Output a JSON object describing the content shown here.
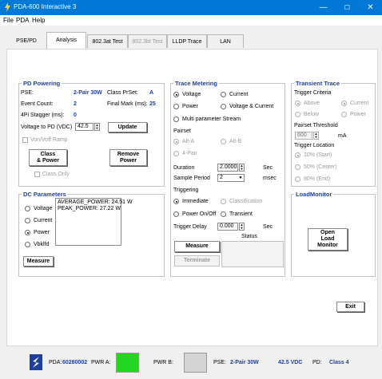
{
  "window": {
    "title": "PDA-600 Interactive 3",
    "min": "—",
    "max": "☐",
    "close": "✕"
  },
  "menu": [
    "File",
    "PDA",
    "Help"
  ],
  "tabs": [
    {
      "label": "PSE/PD"
    },
    {
      "label": "Analysis"
    },
    {
      "label": "802.3at Test"
    },
    {
      "label": "802.3bt Test"
    },
    {
      "label": "LLDP Trace"
    },
    {
      "label": "LAN"
    }
  ],
  "pd_powering": {
    "title": "PD Powering",
    "pse_label": "PSE:",
    "pse_value": "2-Pair 30W",
    "class_prset_label": "Class PrSet:",
    "class_prset_value": "A",
    "event_count_label": "Event Count:",
    "event_count_value": "2",
    "final_mark_label": "Final Mark (ms):",
    "final_mark_value": "25",
    "stagger_label": "4Pi Stagger (ms):",
    "stagger_value": "0",
    "voltage_label": "Voltage to PD (VDC)",
    "voltage_value": "42.5",
    "update_button": "Update",
    "von_voff": "Von/Voff Ramp",
    "class_power_button": "Class\n& Power",
    "remove_power_button": "Remove\nPower",
    "class_only": "Class Only"
  },
  "dc_parameters": {
    "title": "DC Parameters",
    "options": [
      "Voltage",
      "Current",
      "Power",
      "Vbklfd"
    ],
    "selected": "Power",
    "readout": "AVERAGE_POWER: 24.51 W\nPEAK_POWER: 27.22 W",
    "measure_button": "Measure"
  },
  "trace_metering": {
    "title": "Trace Metering",
    "modes": [
      "Voltage",
      "Current",
      "Power",
      "Voltage & Current",
      "Multi parameter Stream"
    ],
    "selected_mode": "Voltage",
    "pairset_label": "Pairset",
    "pairsets": [
      "Alt-A",
      "Alt-B",
      "4-Pair"
    ],
    "duration_label": "Duration",
    "duration_value": "2.0000",
    "duration_unit": "Sec",
    "sample_period_label": "Sample Period",
    "sample_period_value": "2",
    "sample_period_unit": "msec",
    "triggering_label": "Triggering",
    "triggers": [
      "Immediate",
      "Classification",
      "Power On/Off",
      "Transient"
    ],
    "selected_trigger": "Immediate",
    "trigger_delay_label": "Trigger Delay",
    "trigger_delay_value": "0.000",
    "trigger_delay_unit": "Sec",
    "status_label": "Status",
    "measure_button": "Measure",
    "terminate_button": "Terminate"
  },
  "transient_trace": {
    "title": "Transient Trace",
    "criteria_label": "Trigger Criteria",
    "criteria": [
      "Above",
      "Current",
      "Below",
      "Power"
    ],
    "threshold_label": "Pairset Threshold",
    "threshold_value": "600",
    "threshold_unit": "mA",
    "location_label": "Trigger Location",
    "locations": [
      "10% (Start)",
      "50% (Center)",
      "90% (End)"
    ]
  },
  "load_monitor": {
    "title": "LoadMonitor",
    "open_button": "Open\nLoad\nMonitor"
  },
  "exit_button": "Exit",
  "status_bar": {
    "pda_label": "PDA:",
    "pda_value": "60280002",
    "pwr_a_label": "PWR A:",
    "pwr_a_color": "#22d622",
    "pwr_b_label": "PWR B:",
    "pwr_b_color": "#d4d4d4",
    "pse_label": "PSE:",
    "pse_value": "2-Pair 30W",
    "voltage": "42.5 VDC",
    "pd_label": "PD:",
    "pd_value": "Class 4"
  }
}
